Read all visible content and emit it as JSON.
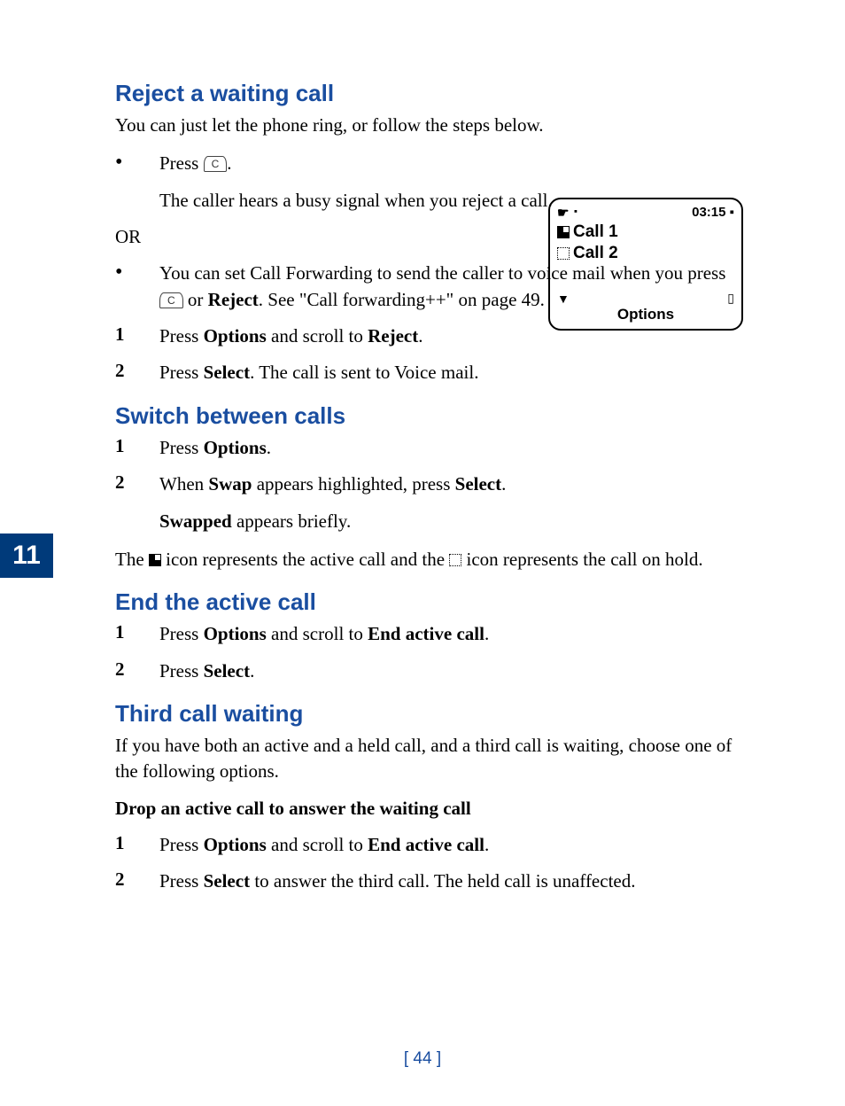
{
  "section_number": "11",
  "page_number": "[ 44 ]",
  "sec1": {
    "heading": "Reject a waiting call",
    "intro": "You can just let the phone ring, or follow the steps below.",
    "b1_pre": "Press ",
    "b1_post": ".",
    "b1_sub": "The caller hears a busy signal when you reject a call.",
    "or": "OR",
    "b2_a": "You can set Call Forwarding to send the caller to voice mail when you press ",
    "b2_b": " or ",
    "b2_bold": "Reject",
    "b2_c": ". See \"Call forwarding++\" on page 49.",
    "s1_a": "Press ",
    "s1_b": "Options",
    "s1_c": " and scroll to ",
    "s1_d": "Reject",
    "s1_e": ".",
    "s2_a": "Press ",
    "s2_b": "Select",
    "s2_c": ". The call is sent to Voice mail."
  },
  "sec2": {
    "heading": "Switch between calls",
    "s1_a": "Press ",
    "s1_b": "Options",
    "s1_c": ".",
    "s2_a": "When ",
    "s2_b": "Swap",
    "s2_c": " appears highlighted, press ",
    "s2_d": "Select",
    "s2_e": ".",
    "s2_sub_a": "Swapped",
    "s2_sub_b": " appears briefly.",
    "p_a": "The ",
    "p_b": " icon represents the active call and the ",
    "p_c": " icon represents the call on hold."
  },
  "sec3": {
    "heading": "End the active call",
    "s1_a": "Press ",
    "s1_b": "Options",
    "s1_c": " and scroll to ",
    "s1_d": "End active call",
    "s1_e": ".",
    "s2_a": "Press ",
    "s2_b": "Select",
    "s2_c": "."
  },
  "sec4": {
    "heading": "Third call waiting",
    "intro": "If you have both an active and a held call, and a third call is waiting, choose one of the following options.",
    "subhead": "Drop an active call to answer the waiting call",
    "s1_a": "Press ",
    "s1_b": "Options",
    "s1_c": " and scroll to ",
    "s1_d": "End active call",
    "s1_e": ".",
    "s2_a": "Press ",
    "s2_b": "Select",
    "s2_c": " to answer the third call. The held call is unaffected."
  },
  "phone": {
    "time": "03:15",
    "line1": "Call 1",
    "line2": "Call 2",
    "softkey": "Options"
  },
  "nums": {
    "n1": "1",
    "n2": "2"
  },
  "key_c": "C"
}
